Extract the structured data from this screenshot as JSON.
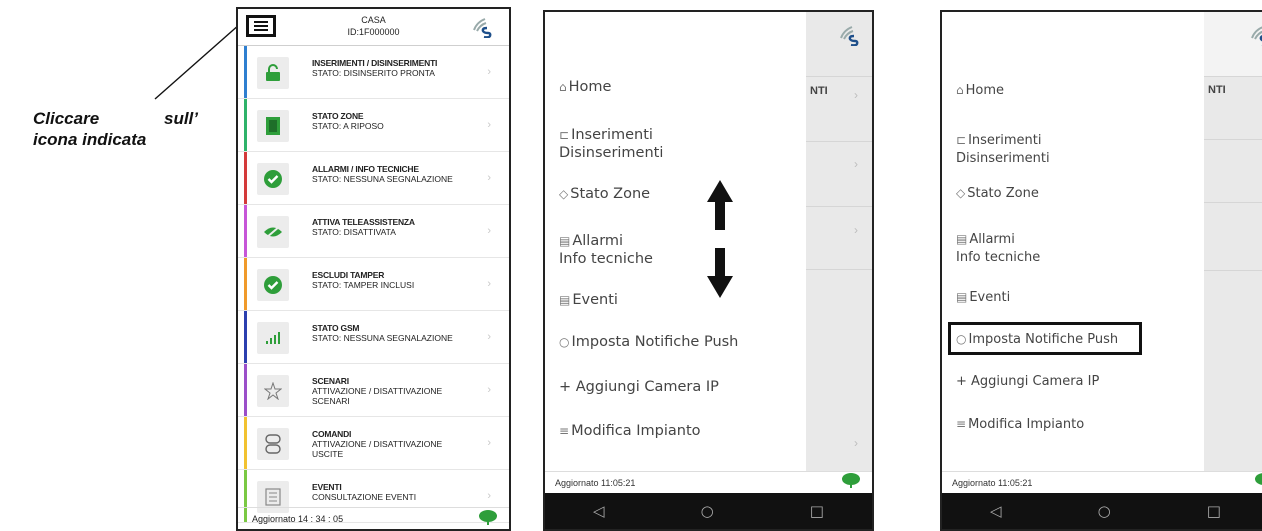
{
  "annotation": {
    "line1_a": "Cliccare",
    "line1_b": "sull’",
    "line2": "icona indicata"
  },
  "phone1": {
    "title": "CASA",
    "subtitle": "ID:1F000000",
    "rows": [
      {
        "title": "INSERIMENTI / DISINSERIMENTI",
        "status": "STATO: DISINSERITO PRONTA",
        "color": "#2f7fd0",
        "icon": "lock-icon"
      },
      {
        "title": "STATO ZONE",
        "status": "STATO: A RIPOSO",
        "color": "#2fb36a",
        "icon": "door-icon"
      },
      {
        "title": "ALLARMI / INFO TECNICHE",
        "status": "STATO: NESSUNA SEGNALAZIONE",
        "color": "#d43a3a",
        "icon": "check-icon"
      },
      {
        "title": "ATTIVA TELEASSISTENZA",
        "status": "STATO: DISATTIVATA",
        "color": "#c756d8",
        "icon": "eye-icon"
      },
      {
        "title": "ESCLUDI TAMPER",
        "status": "STATO: TAMPER INCLUSI",
        "color": "#f09a2a",
        "icon": "check-icon"
      },
      {
        "title": "STATO GSM",
        "status": "STATO: NESSUNA SEGNALAZIONE",
        "color": "#2b3faf",
        "icon": "signal-icon"
      },
      {
        "title": "SCENARI",
        "status": "ATTIVAZIONE / DISATTIVAZIONE SCENARI",
        "color": "#9b4fc9",
        "icon": "star-icon"
      },
      {
        "title": "COMANDI",
        "status": "ATTIVAZIONE / DISATTIVAZIONE USCITE",
        "color": "#f2c230",
        "icon": "switch-icon"
      },
      {
        "title": "EVENTI",
        "status": "CONSULTAZIONE EVENTI",
        "color": "#7ac943",
        "icon": "document-icon"
      }
    ],
    "footer": "Aggiornato 14 : 34 : 05"
  },
  "drawer": {
    "items": [
      {
        "line1": "Home",
        "line2": ""
      },
      {
        "line1": "Inserimenti",
        "line2": "Disinserimenti"
      },
      {
        "line1": "Stato Zone",
        "line2": ""
      },
      {
        "line1": "Allarmi",
        "line2": "Info tecniche"
      },
      {
        "line1": "Eventi",
        "line2": ""
      },
      {
        "line1": "Imposta Notifiche Push",
        "line2": ""
      },
      {
        "line1": "+ Aggiungi Camera IP",
        "line2": ""
      },
      {
        "line1": "Modifica Impianto",
        "line2": ""
      }
    ],
    "bg_label": "NTI",
    "update_text": "Aggiornato 11:05:21"
  },
  "colors": {
    "green": "#2e9e3a",
    "logo_gray": "#9aa",
    "logo_blue": "#1e4f8a"
  }
}
